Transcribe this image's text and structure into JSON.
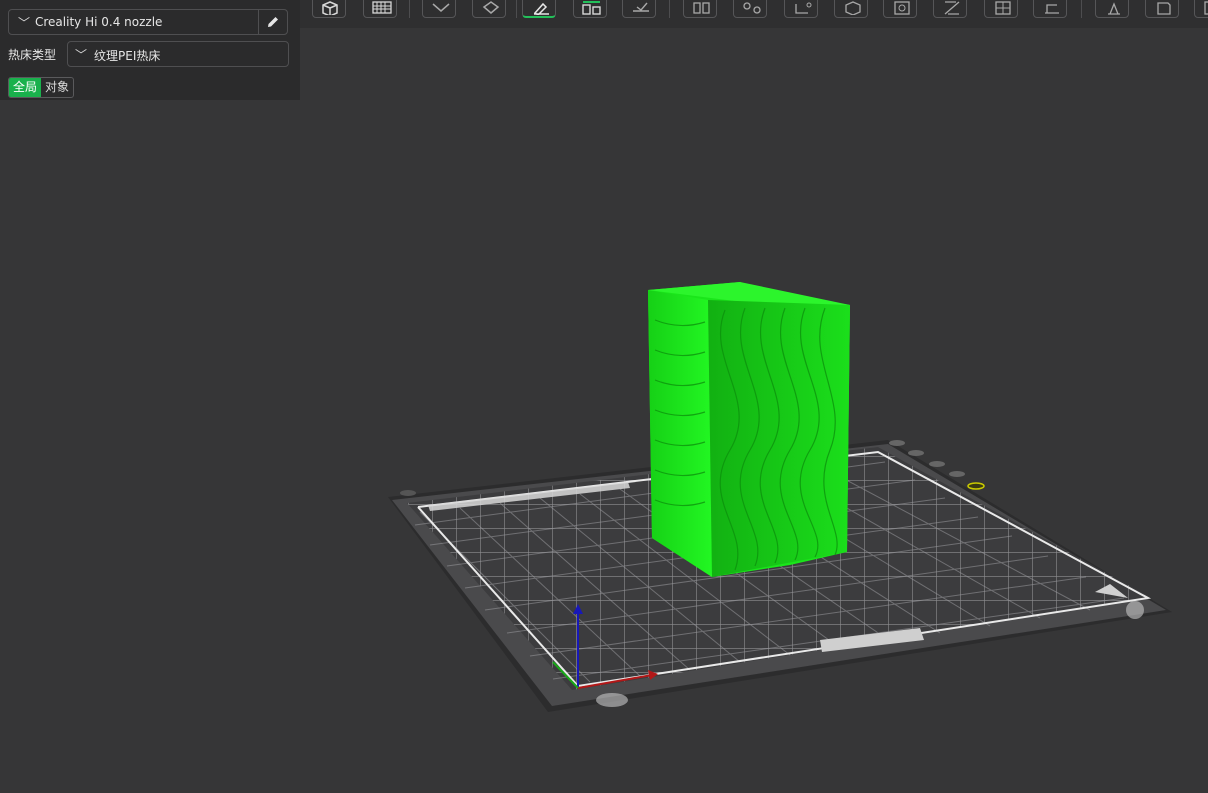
{
  "printer": {
    "name": "Creality Hi 0.4 nozzle"
  },
  "bed": {
    "label": "热床类型",
    "value": "纹理PEI热床"
  },
  "scope_toggle": {
    "global": "全局",
    "object": "对象"
  },
  "toolbar": {
    "icons": [
      "cube-view-icon",
      "grid-plate-icon",
      "auto-orient-icon",
      "lay-on-face-icon",
      "paint-brush-icon",
      "arrange-icon",
      "support-paint-icon",
      "split-objects-icon",
      "split-parts-icon",
      "cut-icon",
      "mesh-boolean-icon",
      "measure-icon",
      "seam-paint-icon",
      "assembly-icon",
      "text-emboss-icon",
      "ruler-icon",
      "multi-material-icon",
      "svg-emboss-icon",
      "more-icon"
    ]
  },
  "colors": {
    "accent": "#19b14c",
    "model": "#1bee1b",
    "background": "#363637"
  }
}
